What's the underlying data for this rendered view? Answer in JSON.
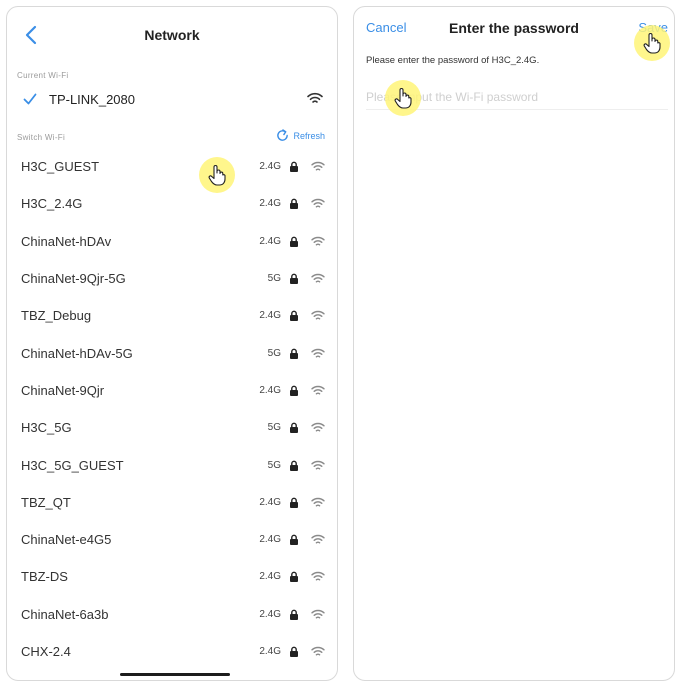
{
  "network": {
    "title": "Network",
    "current_label": "Current Wi-Fi",
    "current_ssid": "TP-LINK_2080",
    "switch_label": "Switch Wi-Fi",
    "refresh_label": "Refresh",
    "networks": [
      {
        "ssid": "H3C_GUEST",
        "band": "2.4G",
        "locked": true
      },
      {
        "ssid": "H3C_2.4G",
        "band": "2.4G",
        "locked": true
      },
      {
        "ssid": "ChinaNet-hDAv",
        "band": "2.4G",
        "locked": true
      },
      {
        "ssid": "ChinaNet-9Qjr-5G",
        "band": "5G",
        "locked": true
      },
      {
        "ssid": "TBZ_Debug",
        "band": "2.4G",
        "locked": true
      },
      {
        "ssid": "ChinaNet-hDAv-5G",
        "band": "5G",
        "locked": true
      },
      {
        "ssid": "ChinaNet-9Qjr",
        "band": "2.4G",
        "locked": true
      },
      {
        "ssid": "H3C_5G",
        "band": "5G",
        "locked": true
      },
      {
        "ssid": "H3C_5G_GUEST",
        "band": "5G",
        "locked": true
      },
      {
        "ssid": "TBZ_QT",
        "band": "2.4G",
        "locked": true
      },
      {
        "ssid": "ChinaNet-e4G5",
        "band": "2.4G",
        "locked": true
      },
      {
        "ssid": "TBZ-DS",
        "band": "2.4G",
        "locked": true
      },
      {
        "ssid": "ChinaNet-6a3b",
        "band": "2.4G",
        "locked": true
      },
      {
        "ssid": "CHX-2.4",
        "band": "2.4G",
        "locked": true
      }
    ]
  },
  "password_dialog": {
    "cancel_label": "Cancel",
    "title": "Enter the password",
    "save_label": "Save",
    "description": "Please enter the password of H3C_2.4G.",
    "input_placeholder": "Please input the Wi-Fi password",
    "input_value": ""
  },
  "colors": {
    "accent": "#3a8ee6",
    "tap_highlight": "#fff578"
  },
  "icons": [
    "back-chevron-icon",
    "check-icon",
    "wifi-icon",
    "refresh-icon",
    "lock-icon",
    "hand-pointer-icon"
  ]
}
